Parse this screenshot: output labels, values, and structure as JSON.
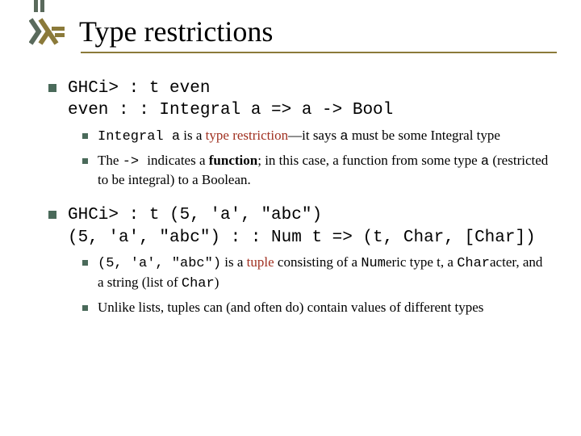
{
  "title": "Type restrictions",
  "block1": {
    "line1": "GHCi> : t even",
    "line2": "even : : Integral a => a -> Bool",
    "sub1_part1": "Integral a",
    "sub1_part2": " is a ",
    "sub1_type_restriction": "type restriction",
    "sub1_part3": "—it says ",
    "sub1_a": "a",
    "sub1_part4": " must be some Integral type",
    "sub2_part1": "The ",
    "sub2_arrow": " -> ",
    "sub2_part2": " indicates a ",
    "sub2_function": "function",
    "sub2_part3": "; in this case, a function from some type ",
    "sub2_a": "a",
    "sub2_part4": " (restricted to be integral) to a Boolean."
  },
  "block2": {
    "line1": "GHCi> : t (5, 'a', \"abc\")",
    "line2": "(5, 'a', \"abc\") : : Num t => (t, Char, [Char])",
    "sub1_tuple": "(5, 'a', \"abc\")",
    "sub1_part1": " is a ",
    "sub1_tupleword": "tuple",
    "sub1_part2": " consisting of a ",
    "sub1_num": "Num",
    "sub1_part3": "eric type t, a ",
    "sub1_char": "Char",
    "sub1_part4": "acter, and a string (list of ",
    "sub1_char2": "Char",
    "sub1_part5": ")",
    "sub2": "Unlike lists, tuples can (and often do) contain values of different types"
  }
}
